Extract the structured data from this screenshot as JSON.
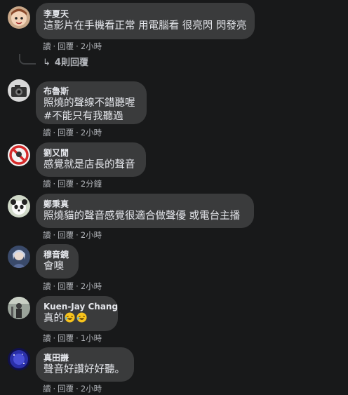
{
  "comments": [
    {
      "author": "李夏天",
      "lines": [
        "這影片在手機看正常 用電腦看 很亮閃 閃發亮"
      ],
      "actions": {
        "reply": "讀",
        "reply_label": "回覆",
        "time": "2小時"
      },
      "replies_label": "4則回覆",
      "avatar_icon": "cartoon-face-avatar"
    },
    {
      "author": "布魯斯",
      "lines": [
        "照燒的聲線不錯聽喔",
        "#不能只有我聽過"
      ],
      "actions": {
        "reply": "讀",
        "reply_label": "回覆",
        "time": "2小時"
      },
      "avatar_icon": "camera-avatar"
    },
    {
      "author": "劉又閒",
      "lines": [
        "感覺就是店長的聲音"
      ],
      "actions": {
        "reply": "讀",
        "reply_label": "回覆",
        "time": "2分鐘"
      },
      "avatar_icon": "prohibition-sign-avatar"
    },
    {
      "author": "鄭秉真",
      "lines": [
        "照燒貓的聲音感覺很適合做聲優 或電台主播"
      ],
      "actions": {
        "reply": "讀",
        "reply_label": "回覆",
        "time": "2小時"
      },
      "avatar_icon": "panda-avatar"
    },
    {
      "author": "穆音鏡",
      "lines": [
        "會噢"
      ],
      "actions": {
        "reply": "讀",
        "reply_label": "回覆",
        "time": "2小時"
      },
      "avatar_icon": "anime-character-avatar"
    },
    {
      "author": "Kuen-Jay Chang",
      "lines": [
        "真的"
      ],
      "emojis": [
        "laughing-emoji",
        "laughing-emoji"
      ],
      "actions": {
        "reply": "讀",
        "reply_label": "回覆",
        "time": "1小時"
      },
      "avatar_icon": "figure-avatar"
    },
    {
      "author": "真田謙",
      "lines": [
        "聲音好讚好好聽。"
      ],
      "actions": {
        "reply": "讀",
        "reply_label": "回覆",
        "time": "2小時"
      },
      "avatar_icon": "night-sky-avatar"
    }
  ],
  "separator": "·",
  "colors": {
    "background": "#18191a",
    "bubble": "#3a3b3c",
    "primary_text": "#e4e6eb",
    "secondary_text": "#b0b3b8"
  }
}
